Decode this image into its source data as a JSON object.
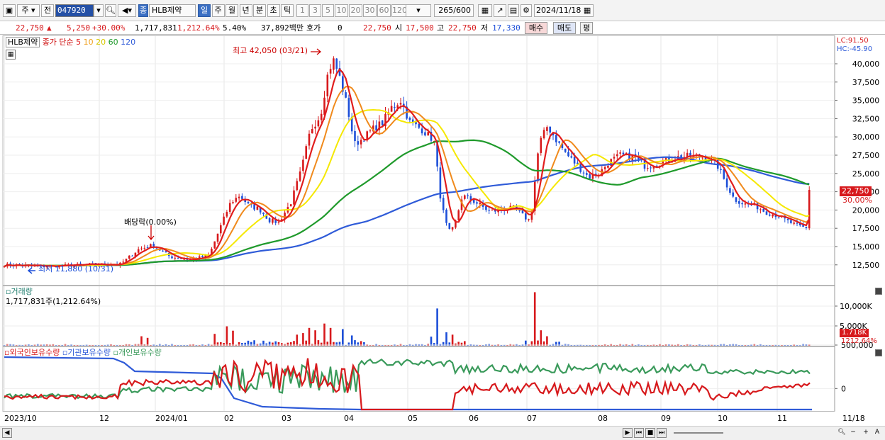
{
  "toolbar": {
    "market": "주",
    "prev_label": "전",
    "code": "047920",
    "name_badge": "종",
    "stock_name": "HLB제약",
    "periods": [
      "일",
      "주",
      "월",
      "년",
      "분",
      "초",
      "틱"
    ],
    "selected_period": "일",
    "minutes": [
      "1",
      "3",
      "5",
      "10",
      "20",
      "30",
      "60",
      "120"
    ],
    "count": "265",
    "count_total": "/600",
    "date": "2024/11/18"
  },
  "quote": {
    "price": "22,750",
    "change": "5,250",
    "change_pct": "+30.00%",
    "volume": "1,717,831",
    "volume_ratio": "1,212.64%",
    "turnover": "5.40%",
    "amount": "37,892백만",
    "hoga_label": "호가",
    "hoga_value": "0",
    "hoga_price": "22,750",
    "open_label": "시",
    "open": "17,500",
    "high_label": "고",
    "high": "22,750",
    "low_label": "저",
    "low": "17,330",
    "buy_label": "매수",
    "sell_label": "매도",
    "eval_label": "평"
  },
  "price_panel": {
    "legend_name": "HLB제약",
    "legend_type": "종가 단순",
    "ma_periods": [
      "5",
      "10",
      "20",
      "60",
      "120"
    ],
    "lc": "LC:91.50",
    "hc": "HC:-45.90",
    "high_annotation": "최고 42,050 (03/21)",
    "low_annotation": "최저 11,880 (10/31)",
    "dividend_annotation": "배당락(0.00%)",
    "last_price_tag": "22,750",
    "last_pct_tag": "30.00%",
    "y_ticks": [
      "40,000",
      "37,500",
      "35,000",
      "32,500",
      "30,000",
      "27,500",
      "25,000",
      "22,500",
      "20,000",
      "17,500",
      "15,000",
      "12,500"
    ]
  },
  "volume_panel": {
    "title": "거래량",
    "value": "1,717,831주(1,212.64%)",
    "y_ticks": [
      "10,000K",
      "5,000K"
    ],
    "tag": "1.718K",
    "tag_pct": "1212.64%"
  },
  "holding_panel": {
    "series": [
      "외국인보유수량",
      "기관보유수량",
      "개인보유수량"
    ],
    "y_ticks": [
      "500,000",
      "0"
    ]
  },
  "x_axis": [
    "2023/10",
    "12",
    "2024/01",
    "02",
    "03",
    "04",
    "05",
    "06",
    "07",
    "08",
    "09",
    "10",
    "11",
    "11/18"
  ],
  "colors": {
    "ma5": "#e11d1d",
    "ma10": "#f08a1c",
    "ma20": "#f5e800",
    "ma60": "#1f9a2b",
    "ma120": "#2f5bd8",
    "up": "#d7191c",
    "down": "#1d4fd8",
    "foreign": "#d7191c",
    "institution": "#2f5bd8",
    "individual": "#3a9a5b"
  },
  "chart_data": {
    "type": "candlestick",
    "x": [
      "2023/10",
      "2023/11",
      "2023/12",
      "2024/01",
      "2024/02",
      "2024/03",
      "2024/04",
      "2024/05",
      "2024/06",
      "2024/07",
      "2024/08",
      "2024/09",
      "2024/10",
      "2024/11/18"
    ],
    "close_approx": [
      12400,
      12600,
      13800,
      13200,
      17500,
      38000,
      30000,
      33500,
      20500,
      20000,
      26500,
      27000,
      20000,
      22750
    ],
    "ylim": [
      11000,
      42500
    ]
  }
}
